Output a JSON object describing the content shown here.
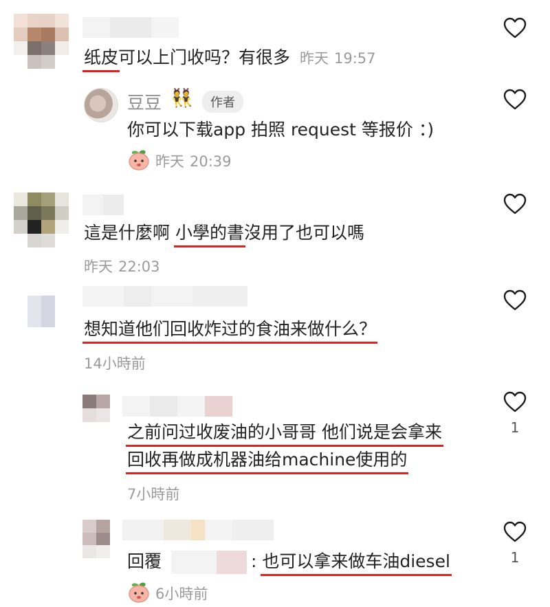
{
  "comments": [
    {
      "text_underlined": "纸皮",
      "text_rest": "可以上门收吗？有很多",
      "date": "昨天",
      "time": "19:57",
      "reply": {
        "author_name": "豆豆",
        "author_emoji": "👯",
        "author_tag": "作者",
        "text": "你可以下载app 拍照 request 等报价 ：)",
        "date": "昨天",
        "time": "20:39"
      }
    },
    {
      "text_before": "這是什麼啊 ",
      "text_underlined": "小學的書",
      "text_after": "沒用了也可以嗎",
      "date": "昨天",
      "time": "22:03"
    },
    {
      "text_underlined": "想知道他们回收炸过的食油来做什么？",
      "timestamp": "14小時前",
      "replies": [
        {
          "line1": "之前问过收废油的小哥哥 他们说是会拿来",
          "line2": "回收再做成机器油给machine使用的",
          "timestamp": "7小時前",
          "likes": "1"
        },
        {
          "prefix": "回覆",
          "colon": ":",
          "text_underlined": "也可以拿来做车油diesel",
          "timestamp": "6小時前",
          "likes": "1"
        }
      ]
    }
  ],
  "icons": {
    "like": "heart-outline-icon",
    "reaction": "peach-emoji-icon"
  },
  "colors": {
    "underline": "#e0201c",
    "meta": "#9a9a9a",
    "text": "#222222"
  }
}
